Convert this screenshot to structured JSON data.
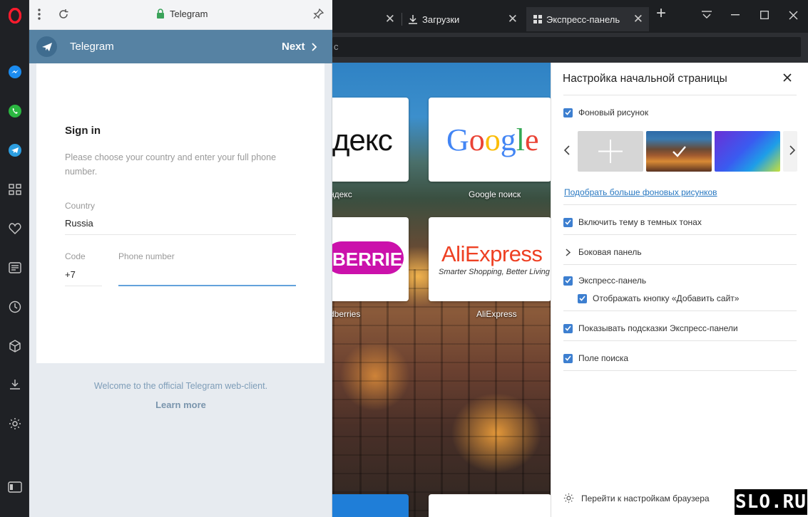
{
  "browser": {
    "tabs": [
      {
        "label": ""
      },
      {
        "label": "Загрузки"
      },
      {
        "label": "Экспресс-панель"
      }
    ],
    "address_fragment": "c"
  },
  "telegram_panel": {
    "window_title": "Telegram",
    "header_title": "Telegram",
    "next_label": "Next",
    "sign_in_title": "Sign in",
    "instructions": "Please choose your country and enter your full phone number.",
    "country_label": "Country",
    "country_value": "Russia",
    "code_label": "Code",
    "code_value": "+7",
    "phone_label": "Phone number",
    "phone_value": "",
    "welcome_text": "Welcome to the official Telegram web-client.",
    "learn_more": "Learn more"
  },
  "speed_dial": {
    "tiles": [
      {
        "logo": "декс",
        "caption": "ндекс"
      },
      {
        "logo": "Google",
        "caption": "Google поиск"
      },
      {
        "logo": "BERRIES",
        "caption": "dberries"
      },
      {
        "logo": "AliExpress",
        "tagline": "Smarter Shopping, Better Living",
        "caption": "AliExpress"
      }
    ]
  },
  "settings_panel": {
    "title": "Настройка начальной страницы",
    "background_label": "Фоновый рисунок",
    "more_backgrounds_link": "Подобрать больше фоновых рисунков",
    "dark_theme_label": "Включить тему в темных тонах",
    "sidebar_label": "Боковая панель",
    "speed_dial_label": "Экспресс-панель",
    "add_site_button_label": "Отображать кнопку «Добавить сайт»",
    "speed_dial_hints_label": "Показывать подсказки Экспресс-панели",
    "search_field_label": "Поле поиска",
    "browser_settings_link": "Перейти к настройкам браузера"
  },
  "watermark": "SLO.RU",
  "colors": {
    "telegram_header": "#5682a3",
    "link_blue": "#2a79c2",
    "checkbox_blue": "#3d7fd0",
    "opera_red": "#ff1b2d"
  }
}
